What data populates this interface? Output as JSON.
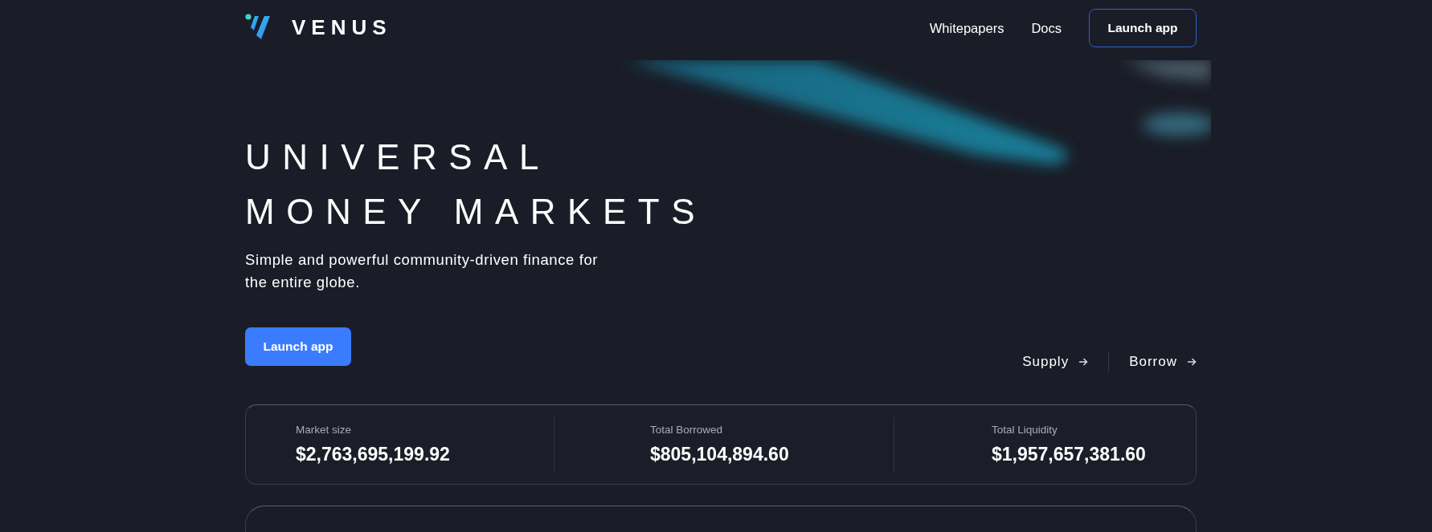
{
  "header": {
    "logo_text": "VENUS",
    "links": [
      {
        "label": "Whitepapers"
      },
      {
        "label": "Docs"
      }
    ],
    "button": "Launch app"
  },
  "hero": {
    "title_lines": [
      "UNIVERSAL",
      "MONEY MARKETS"
    ],
    "subtitle": "Simple and powerful community-driven finance for the entire globe.",
    "button": "Launch app",
    "links": [
      {
        "label": "Supply"
      },
      {
        "label": "Borrow"
      }
    ]
  },
  "stats": [
    {
      "label": "Market size",
      "value": "$2,763,695,199.92"
    },
    {
      "label": "Total Borrowed",
      "value": "$805,104,894.60"
    },
    {
      "label": "Total Liquidity",
      "value": "$1,957,657,381.60"
    }
  ]
}
